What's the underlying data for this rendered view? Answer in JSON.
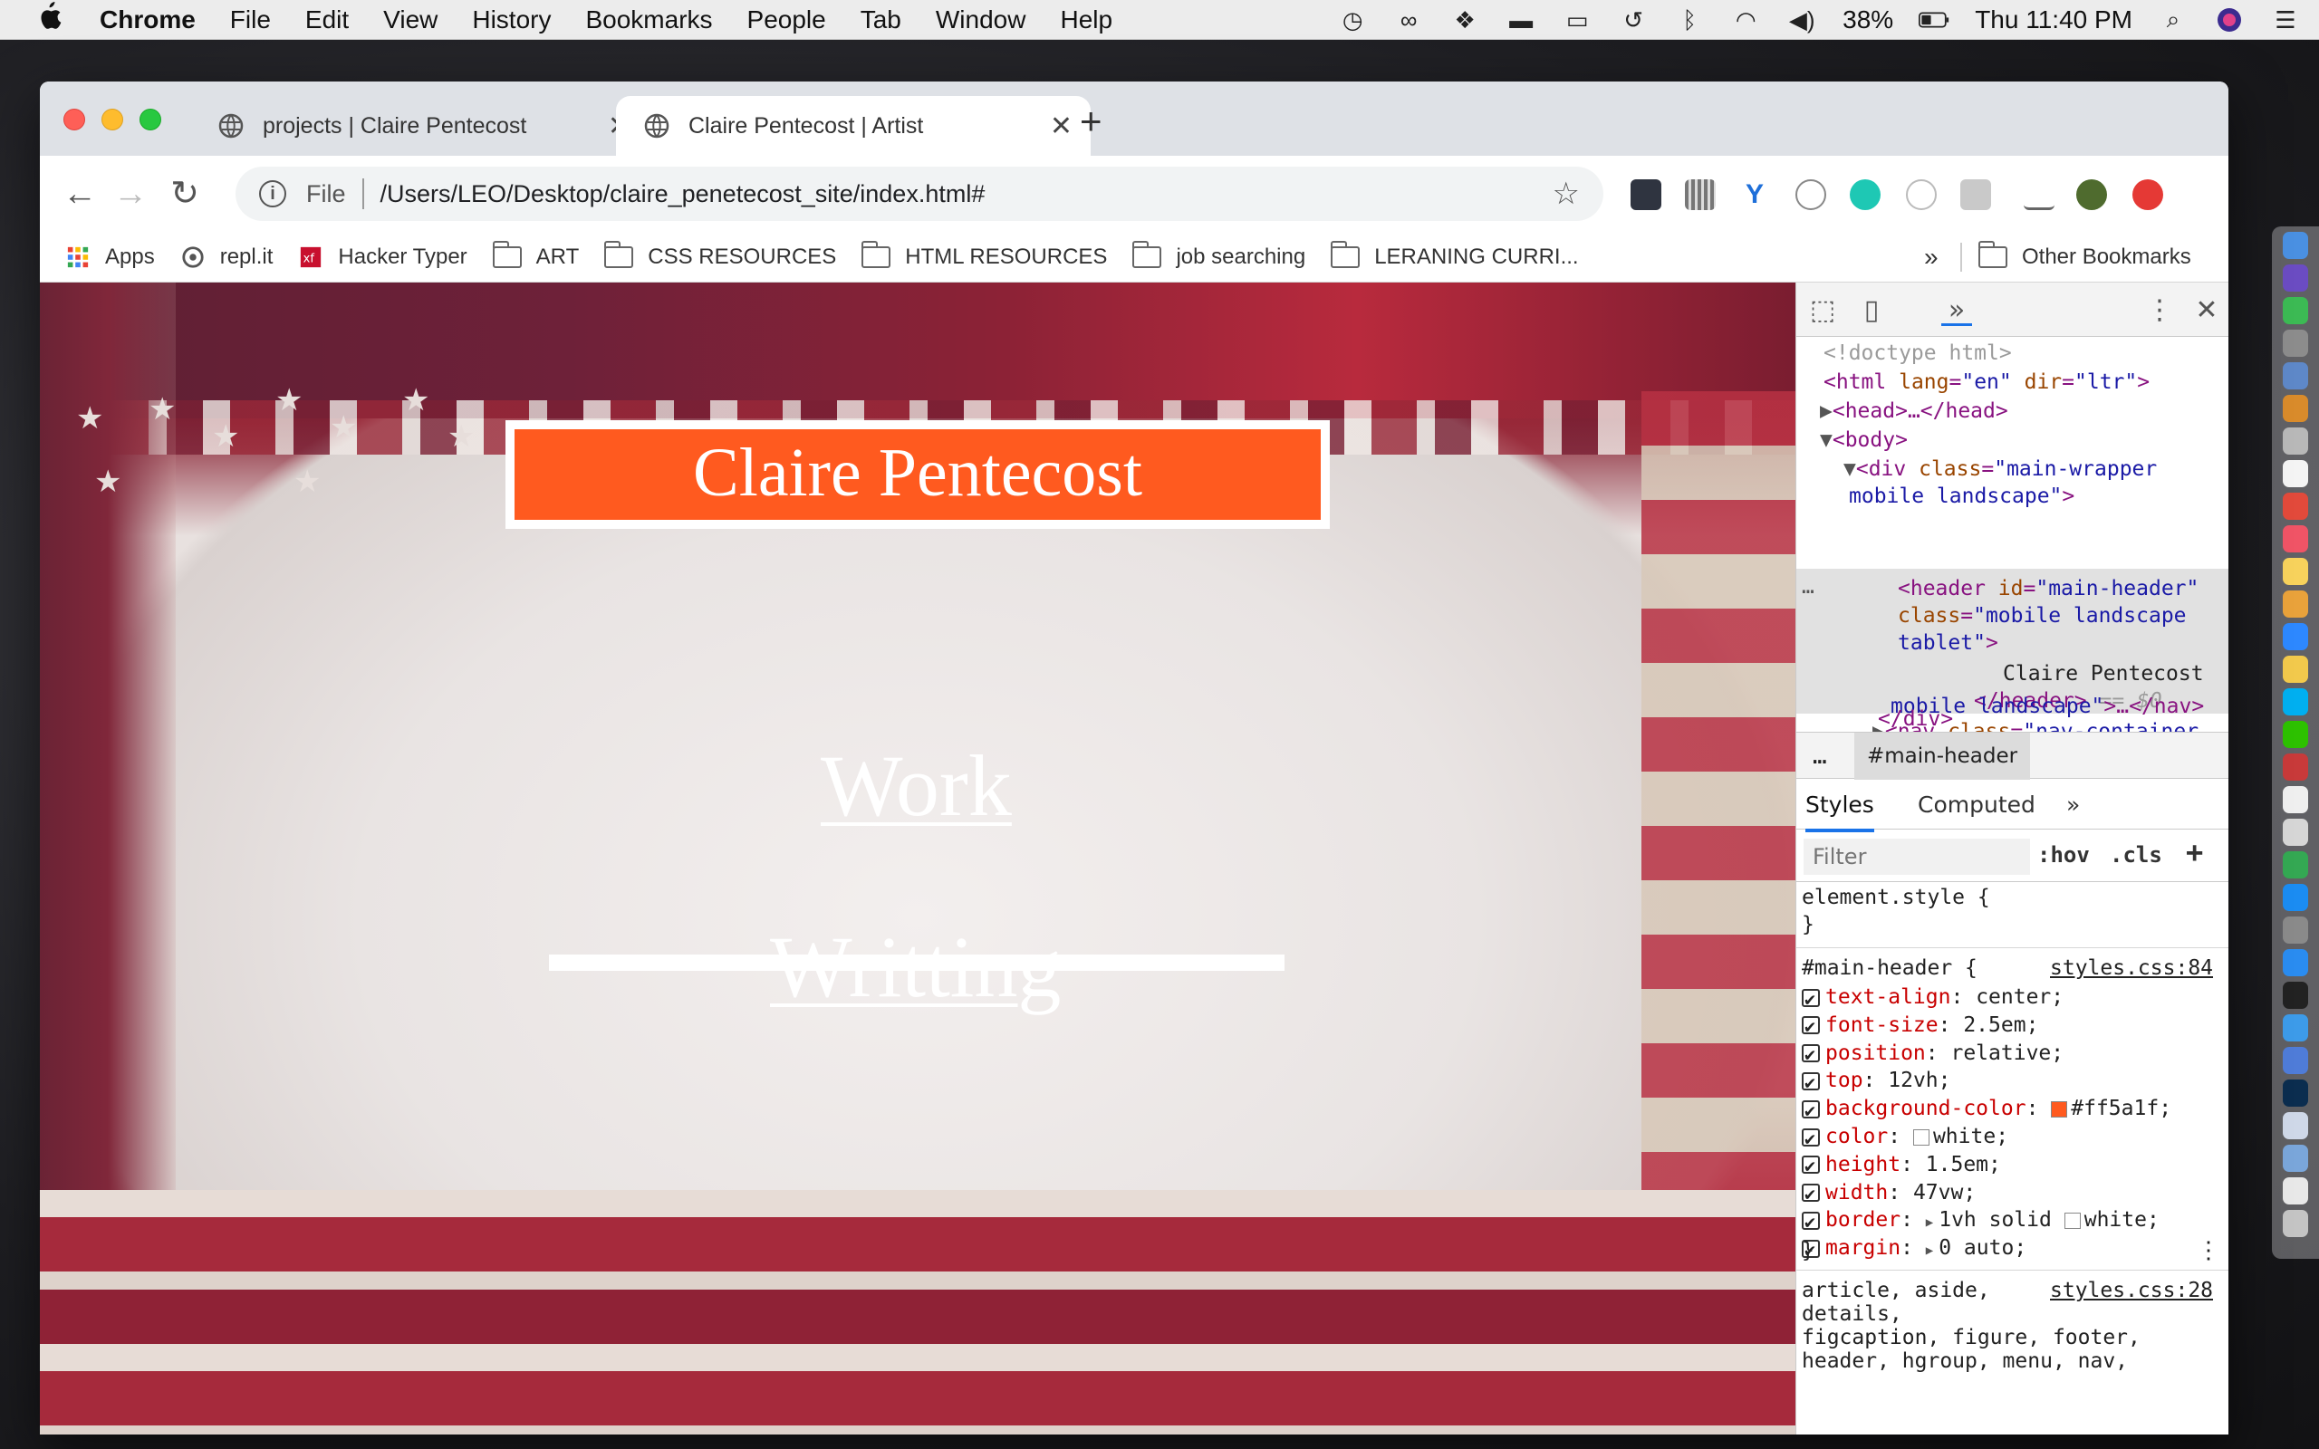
{
  "menubar": {
    "app_name": "Chrome",
    "items": [
      "File",
      "Edit",
      "View",
      "History",
      "Bookmarks",
      "People",
      "Tab",
      "Window",
      "Help"
    ],
    "battery": "38%",
    "clock": "Thu 11:40 PM"
  },
  "tabs": [
    {
      "title": "projects | Claire Pentecost",
      "active": false
    },
    {
      "title": "Claire Pentecost | Artist",
      "active": true
    }
  ],
  "omnibox": {
    "scheme": "File",
    "url": "/Users/LEO/Desktop/claire_penetecost_site/index.html#"
  },
  "bookmarks": [
    {
      "label": "Apps",
      "icon": "apps-grid-icon"
    },
    {
      "label": "repl.it",
      "icon": "replit-icon"
    },
    {
      "label": "Hacker Typer",
      "icon": "hackertyper-icon"
    },
    {
      "label": "ART",
      "icon": "folder-icon"
    },
    {
      "label": "CSS RESOURCES",
      "icon": "folder-icon"
    },
    {
      "label": "HTML RESOURCES",
      "icon": "folder-icon"
    },
    {
      "label": "job searching",
      "icon": "folder-icon"
    },
    {
      "label": "LERANING CURRI...",
      "icon": "folder-icon"
    }
  ],
  "bookmarks_more": "»",
  "other_bookmarks": "Other Bookmarks",
  "page": {
    "header": "Claire Pentecost",
    "nav": [
      "Work",
      "Writting"
    ]
  },
  "devtools": {
    "dom_lines": {
      "doctype": "<!doctype html>",
      "html_tag": "html",
      "html_lang_attr": "lang",
      "html_lang_val": "\"en\"",
      "html_dir_attr": "dir",
      "html_dir_val": "\"ltr\"",
      "head": "<head>…</head>",
      "body": "<body>",
      "div_tag": "<div",
      "div_class_attr": "class",
      "div_class_val_1": "\"main-wrapper",
      "div_class_val_2": "mobile landscape\"",
      "header_tag": "<header",
      "header_id_attr": "id",
      "header_id_val": "\"main-header\"",
      "header_class_attr": "class",
      "header_class_val_1": "\"mobile landscape",
      "header_class_val_2": "tablet\"",
      "header_text": "Claire Pentecost",
      "header_close": "</header>",
      "header_eq": "== $0",
      "nav_tag": "<nav",
      "nav_class_attr": "class",
      "nav_class_val_1": "\"nav-container",
      "nav_class_val_2": "mobile landscape\"",
      "nav_close": ">…</nav>",
      "div_close": "</div>"
    },
    "breadcrumb": "#main-header",
    "style_tabs": [
      "Styles",
      "Computed",
      "»"
    ],
    "filter_placeholder": "Filter",
    "hov": ":hov",
    "cls": ".cls",
    "element_style": "element.style {",
    "close_brace": "}",
    "rule_selector": "#main-header {",
    "rule_source": "styles.css:84",
    "declarations": [
      {
        "prop": "text-align",
        "value": "center;"
      },
      {
        "prop": "font-size",
        "value": "2.5em;"
      },
      {
        "prop": "position",
        "value": "relative;"
      },
      {
        "prop": "top",
        "value": "12vh;"
      },
      {
        "prop": "background-color",
        "value": "#ff5a1f;",
        "swatch": "#ff5a1f"
      },
      {
        "prop": "color",
        "value": "white;",
        "swatch": "#ffffff"
      },
      {
        "prop": "height",
        "value": "1.5em;"
      },
      {
        "prop": "width",
        "value": "47vw;"
      },
      {
        "prop": "border",
        "value": "1vh solid",
        "value2": "white;",
        "swatch": "#ffffff",
        "expand": true
      },
      {
        "prop": "margin",
        "value": "0 auto;",
        "expand": true
      }
    ],
    "rule2_selector_1": "article, aside,",
    "rule2_source": "styles.css:28",
    "rule2_selector_2": "details,",
    "rule2_selector_3": "figcaption, figure, footer,",
    "rule2_selector_4": "header, hgroup, menu, nav,"
  },
  "colors": {
    "accent_orange": "#ff5a1f",
    "chrome_tabstrip": "#dee1e6"
  }
}
